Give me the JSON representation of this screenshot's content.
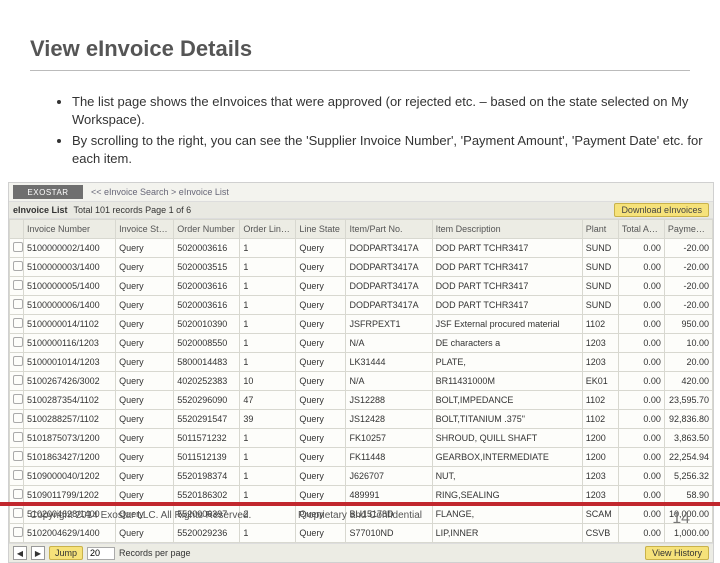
{
  "title": "View eInvoice Details",
  "bullets": [
    "The list page shows the eInvoices that were approved (or rejected etc. – based on the state selected on My Workspace).",
    "By scrolling to the right, you can see the 'Supplier Invoice Number', 'Payment Amount', 'Payment Date' etc. for each item."
  ],
  "app": {
    "logo": "EXOSTAR",
    "breadcrumb": "<<  eInvoice Search > eInvoice List",
    "listLabel": "eInvoice List",
    "listMeta": "Total 101 records Page 1 of 6",
    "downloadBtn": "Download eInvoices",
    "columns": [
      "",
      "Invoice Number",
      "Invoice State",
      "Order Number",
      "Order Line ID",
      "Line State",
      "Item/Part No.",
      "Item Description",
      "Plant",
      "Total Amount",
      "Payment Amt"
    ],
    "rows": [
      {
        "inv": "5100000002/1400",
        "state": "Query",
        "ord": "5020003616",
        "line": "1",
        "lstate": "Query",
        "item": "DODPART3417A",
        "desc": "DOD PART TCHR3417",
        "plant": "SUND",
        "tot": "0.00",
        "pay": "-20.00"
      },
      {
        "inv": "5100000003/1400",
        "state": "Query",
        "ord": "5020003515",
        "line": "1",
        "lstate": "Query",
        "item": "DODPART3417A",
        "desc": "DOD PART TCHR3417",
        "plant": "SUND",
        "tot": "0.00",
        "pay": "-20.00"
      },
      {
        "inv": "5100000005/1400",
        "state": "Query",
        "ord": "5020003616",
        "line": "1",
        "lstate": "Query",
        "item": "DODPART3417A",
        "desc": "DOD PART TCHR3417",
        "plant": "SUND",
        "tot": "0.00",
        "pay": "-20.00"
      },
      {
        "inv": "5100000006/1400",
        "state": "Query",
        "ord": "5020003616",
        "line": "1",
        "lstate": "Query",
        "item": "DODPART3417A",
        "desc": "DOD PART TCHR3417",
        "plant": "SUND",
        "tot": "0.00",
        "pay": "-20.00"
      },
      {
        "inv": "5100000014/1102",
        "state": "Query",
        "ord": "5020010390",
        "line": "1",
        "lstate": "Query",
        "item": "JSFRPEXT1",
        "desc": "JSF External procured material",
        "plant": "1102",
        "tot": "0.00",
        "pay": "950.00"
      },
      {
        "inv": "5100000116/1203",
        "state": "Query",
        "ord": "5020008550",
        "line": "1",
        "lstate": "Query",
        "item": "N/A",
        "desc": "DE characters a",
        "plant": "1203",
        "tot": "0.00",
        "pay": "10.00"
      },
      {
        "inv": "5100001014/1203",
        "state": "Query",
        "ord": "5800014483",
        "line": "1",
        "lstate": "Query",
        "item": "LK31444",
        "desc": "PLATE,",
        "plant": "1203",
        "tot": "0.00",
        "pay": "20.00"
      },
      {
        "inv": "5100267426/3002",
        "state": "Query",
        "ord": "4020252383",
        "line": "10",
        "lstate": "Query",
        "item": "N/A",
        "desc": "BR11431000M",
        "plant": "EK01",
        "tot": "0.00",
        "pay": "420.00"
      },
      {
        "inv": "5100287354/1102",
        "state": "Query",
        "ord": "5520296090",
        "line": "47",
        "lstate": "Query",
        "item": "JS12288",
        "desc": "BOLT,IMPEDANCE",
        "plant": "1102",
        "tot": "0.00",
        "pay": "23,595.70"
      },
      {
        "inv": "5100288257/1102",
        "state": "Query",
        "ord": "5520291547",
        "line": "39",
        "lstate": "Query",
        "item": "JS12428",
        "desc": "BOLT,TITANIUM .375\"",
        "plant": "1102",
        "tot": "0.00",
        "pay": "92,836.80"
      },
      {
        "inv": "5101875073/1200",
        "state": "Query",
        "ord": "5011571232",
        "line": "1",
        "lstate": "Query",
        "item": "FK10257",
        "desc": "SHROUD, QUILL SHAFT",
        "plant": "1200",
        "tot": "0.00",
        "pay": "3,863.50"
      },
      {
        "inv": "5101863427/1200",
        "state": "Query",
        "ord": "5011512139",
        "line": "1",
        "lstate": "Query",
        "item": "FK11448",
        "desc": "GEARBOX,INTERMEDIATE",
        "plant": "1200",
        "tot": "0.00",
        "pay": "22,254.94"
      },
      {
        "inv": "5109000040/1202",
        "state": "Query",
        "ord": "5520198374",
        "line": "1",
        "lstate": "Query",
        "item": "J626707",
        "desc": "NUT,",
        "plant": "1203",
        "tot": "0.00",
        "pay": "5,256.32"
      },
      {
        "inv": "5109011799/1202",
        "state": "Query",
        "ord": "5520186302",
        "line": "1",
        "lstate": "Query",
        "item": "489991",
        "desc": "RING,SEALING",
        "plant": "1203",
        "tot": "0.00",
        "pay": "58.90"
      },
      {
        "inv": "5102004628/1400",
        "state": "Query",
        "ord": "5520006397",
        "line": "2",
        "lstate": "Query",
        "item": "BU15178D",
        "desc": "FLANGE,",
        "plant": "SCAM",
        "tot": "0.00",
        "pay": "10,000.00"
      },
      {
        "inv": "5102004629/1400",
        "state": "Query",
        "ord": "5520029236",
        "line": "1",
        "lstate": "Query",
        "item": "S77010ND",
        "desc": "LIP,INNER",
        "plant": "CSVB",
        "tot": "0.00",
        "pay": "1,000.00"
      }
    ],
    "pager": {
      "prev": "◀",
      "next": "▶",
      "jump": "Jump",
      "size": "20",
      "perPage": "Records per page",
      "history": "View History"
    }
  },
  "footer": {
    "left": "Copyright 2014 Exostar LLC. All Rights Reserved.",
    "mid": "Proprietary and Confidential",
    "page": "14"
  }
}
